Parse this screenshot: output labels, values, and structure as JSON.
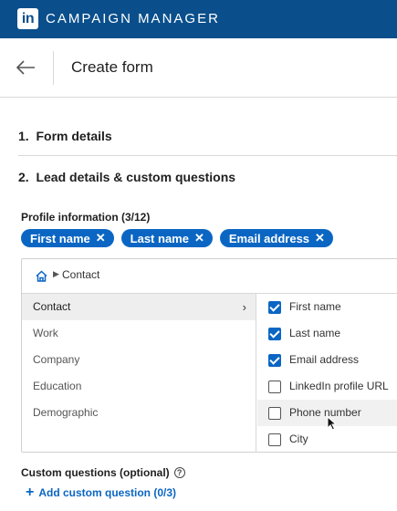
{
  "topbar": {
    "logo": "in",
    "brand": "CAMPAIGN MANAGER"
  },
  "header": {
    "title": "Create form"
  },
  "sections": [
    {
      "number": "1.",
      "label": "Form details"
    },
    {
      "number": "2.",
      "label": "Lead details & custom questions"
    }
  ],
  "profile": {
    "label": "Profile information (3/12)",
    "pills": [
      {
        "label": "First name"
      },
      {
        "label": "Last name"
      },
      {
        "label": "Email address"
      }
    ]
  },
  "picker": {
    "breadcrumb": "Contact",
    "categories": [
      {
        "label": "Contact"
      },
      {
        "label": "Work"
      },
      {
        "label": "Company"
      },
      {
        "label": "Education"
      },
      {
        "label": "Demographic"
      }
    ],
    "active_category": "Contact",
    "options": [
      {
        "label": "First name",
        "checked": true
      },
      {
        "label": "Last name",
        "checked": true
      },
      {
        "label": "Email address",
        "checked": true
      },
      {
        "label": "LinkedIn profile URL",
        "checked": false
      },
      {
        "label": "Phone number",
        "checked": false
      },
      {
        "label": "City",
        "checked": false
      }
    ]
  },
  "custom_questions": {
    "label": "Custom questions (optional)",
    "help": "?",
    "add_label": "Add custom question (0/3)"
  },
  "colors": {
    "brand_bar": "#0a4f8c",
    "accent": "#0b66c3"
  }
}
